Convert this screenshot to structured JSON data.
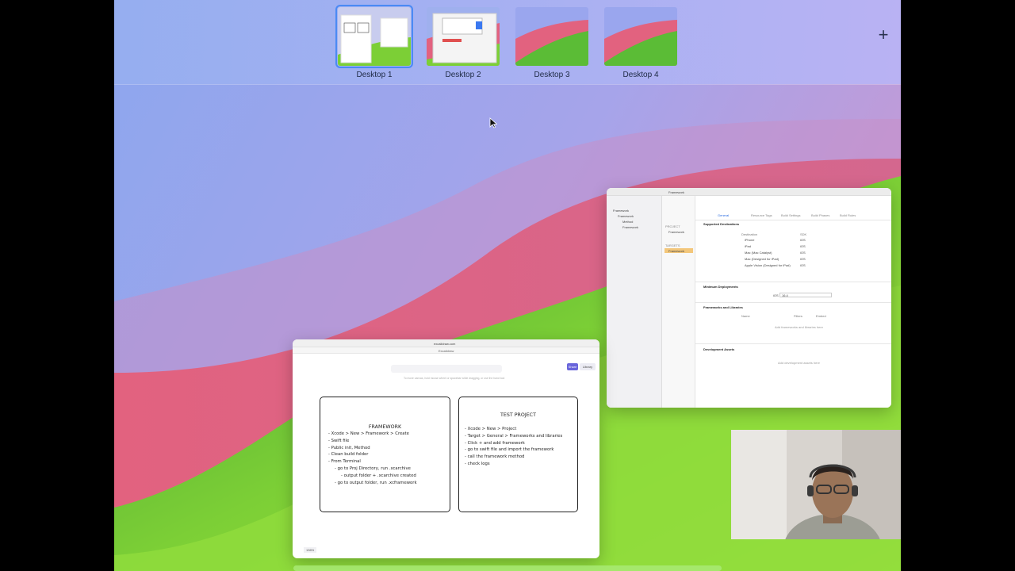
{
  "desktops": [
    {
      "label": "Desktop 1",
      "active": true
    },
    {
      "label": "Desktop 2",
      "active": false
    },
    {
      "label": "Desktop 3",
      "active": false
    },
    {
      "label": "Desktop 4",
      "active": false
    }
  ],
  "add_space_label": "+",
  "colors": {
    "accent": "#4a8af4",
    "wallpaper_pink": "#e8607a",
    "wallpaper_green": "#7fd23a",
    "wallpaper_blue": "#8fa8f0"
  },
  "xcode": {
    "title": "Framework",
    "nav_items": [
      "Framework",
      "Framework",
      "Method",
      "Framework"
    ],
    "project_header": "PROJECT",
    "project_name": "Framework",
    "targets_header": "TARGETS",
    "target_name": "Framework",
    "tabs": [
      "General",
      "Resource Tags",
      "Build Settings",
      "Build Phases",
      "Build Rules"
    ],
    "supported_destinations": "Supported Destinations",
    "dest_col": "Destination",
    "sdk_col": "SDK",
    "destinations": [
      {
        "name": "iPhone",
        "sdk": "iOS"
      },
      {
        "name": "iPad",
        "sdk": "iOS"
      },
      {
        "name": "Mac (Mac Catalyst)",
        "sdk": "iOS"
      },
      {
        "name": "Mac (Designed for iPad)",
        "sdk": "iOS"
      },
      {
        "name": "Apple Vision (Designed for iPad)",
        "sdk": "iOS"
      }
    ],
    "minimum_deployments": "Minimum Deployments",
    "ios_label": "iOS",
    "ios_version": "16.4",
    "frameworks_header": "Frameworks and Libraries",
    "fw_cols": [
      "Name",
      "Filters",
      "Embed"
    ],
    "fw_empty": "Add frameworks and libraries here",
    "dev_assets_header": "Development Assets",
    "dev_assets_empty": "Add development assets here"
  },
  "freeform": {
    "url": "excalidraw.com",
    "tab_title": "Excalidraw",
    "toolbar_hint": "To move canvas, hold mouse wheel or spacebar while dragging, or use the hand tool",
    "share_label": "Share",
    "library_label": "Library",
    "zoom": "136%",
    "card1": {
      "title": "FRAMEWORK",
      "lines": [
        "- Xcode > New > Framework > Create",
        "- Swift file",
        "- Public init, Method",
        "- Clean build folder",
        "- From Terminal",
        "   - go to Proj Directory, run .xcarchive",
        "      - output folder + .xcarchive created",
        "   - go to output folder, run .xcframework"
      ]
    },
    "card2": {
      "title": "TEST PROJECT",
      "lines": [
        "- Xcode > New > Project",
        "- Target > General > Frameworks and libraries",
        "- Click + and add framework",
        "- go to swift file and import the framework",
        "- call the framework method",
        "- check logs"
      ]
    }
  }
}
